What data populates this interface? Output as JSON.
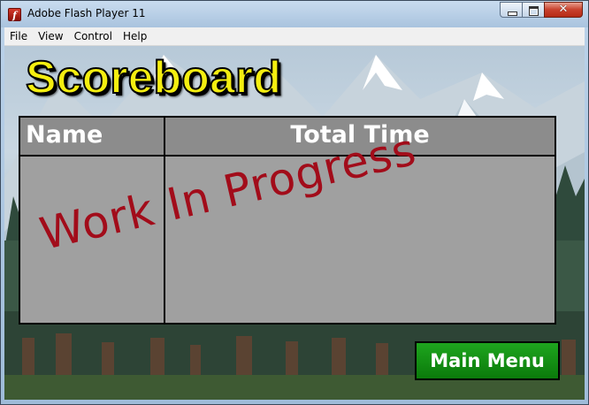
{
  "window": {
    "title": "Adobe Flash Player 11",
    "close_glyph": "✕"
  },
  "menu": {
    "items": [
      "File",
      "View",
      "Control",
      "Help"
    ]
  },
  "game": {
    "title": "Scoreboard",
    "table": {
      "columns": [
        "Name",
        "Total Time"
      ],
      "rows": []
    },
    "overlay_text": "Work In Progress",
    "main_menu_label": "Main Menu"
  },
  "colors": {
    "title_yellow": "#f4ee10",
    "table_gray": "#a0a0a0",
    "wip_red": "#a20c1a",
    "button_green": "#0f8c0f"
  },
  "icons": {
    "app": "flash-player-icon",
    "minimize": "minimize-icon",
    "maximize": "maximize-icon",
    "close": "close-icon"
  }
}
